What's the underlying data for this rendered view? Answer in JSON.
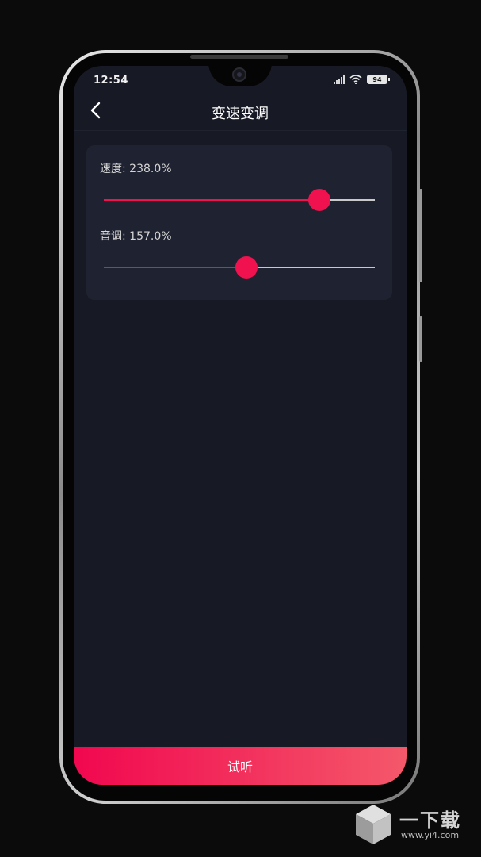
{
  "status_bar": {
    "time": "12:54",
    "battery": "94"
  },
  "header": {
    "title": "变速变调",
    "back_icon": "chevron-left-icon"
  },
  "controls": {
    "speed": {
      "label": "速度: 238.0%",
      "level": 0.795
    },
    "pitch": {
      "label": "音调: 157.0%",
      "level": 0.525
    }
  },
  "footer": {
    "listen_label": "试听"
  },
  "watermark": {
    "text": "一下载",
    "url": "www.yi4.com"
  },
  "colors": {
    "accent": "#f0124f",
    "background": "#171a25",
    "card": "#1f2230"
  }
}
